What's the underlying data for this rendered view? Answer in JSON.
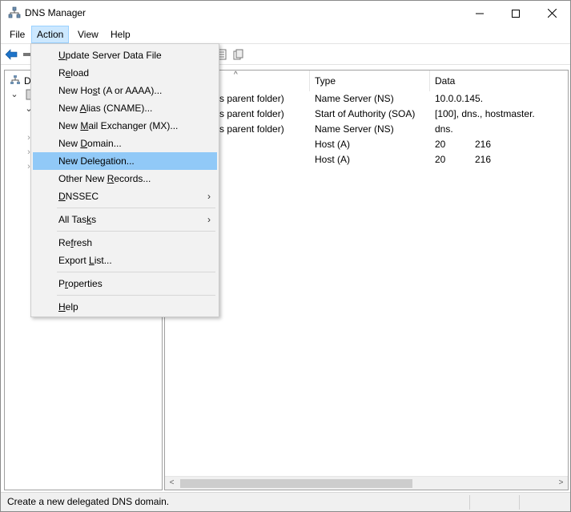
{
  "window": {
    "title": "DNS Manager",
    "minimize_glyph": "─",
    "maximize_glyph": "☐",
    "close_glyph": "✕"
  },
  "menubar": {
    "items": [
      {
        "label": "File"
      },
      {
        "label": "Action"
      },
      {
        "label": "View"
      },
      {
        "label": "Help"
      }
    ]
  },
  "tree": {
    "nodes": [
      {
        "label": "D",
        "chevron": ""
      },
      {
        "label": "",
        "chevron": "⌄"
      },
      {
        "label": "",
        "chevron": "⌄"
      }
    ]
  },
  "list": {
    "columns": [
      {
        "label": ""
      },
      {
        "label": "Type"
      },
      {
        "label": "Data"
      }
    ],
    "rows": [
      {
        "name": "(same as parent folder)",
        "type": "Name Server (NS)",
        "data": "10.0.0.145.",
        "data2": ""
      },
      {
        "name": "(same as parent folder)",
        "type": "Start of Authority (SOA)",
        "data": "[100], dns., hostmaster.",
        "data2": ""
      },
      {
        "name": "(same as parent folder)",
        "type": "Name Server (NS)",
        "data": "dns.",
        "data2": ""
      },
      {
        "name": "",
        "type": "Host (A)",
        "data": "20",
        "data2": "216"
      },
      {
        "name": "",
        "type": "Host (A)",
        "data": "20",
        "data2": "216"
      }
    ],
    "visible_name_fragment": "s parent folder)"
  },
  "action_menu": {
    "items": [
      {
        "pre": "",
        "u": "U",
        "post": "pdate Server Data File"
      },
      {
        "pre": "R",
        "u": "e",
        "post": "load"
      },
      {
        "pre": "New Ho",
        "u": "s",
        "post": "t (A or AAAA)..."
      },
      {
        "pre": "New ",
        "u": "A",
        "post": "lias (CNAME)..."
      },
      {
        "pre": "New ",
        "u": "M",
        "post": "ail Exchanger (MX)..."
      },
      {
        "pre": "New ",
        "u": "D",
        "post": "omain..."
      },
      {
        "pre": "New Dele",
        "u": "g",
        "post": "ation..."
      },
      {
        "pre": "Other New ",
        "u": "R",
        "post": "ecords..."
      },
      {
        "pre": "",
        "u": "D",
        "post": "NSSEC"
      },
      {
        "pre": "All Tas",
        "u": "k",
        "post": "s"
      },
      {
        "pre": "Re",
        "u": "f",
        "post": "resh"
      },
      {
        "pre": "Export ",
        "u": "L",
        "post": "ist..."
      },
      {
        "pre": "P",
        "u": "r",
        "post": "operties"
      },
      {
        "pre": "",
        "u": "H",
        "post": "elp"
      }
    ],
    "submenu_glyph": "›"
  },
  "status": {
    "text": "Create a new delegated DNS domain."
  },
  "colors": {
    "menu_highlight": "#91c9f7",
    "menubar_active": "#cce8ff",
    "back_arrow": "#1e73c8"
  }
}
